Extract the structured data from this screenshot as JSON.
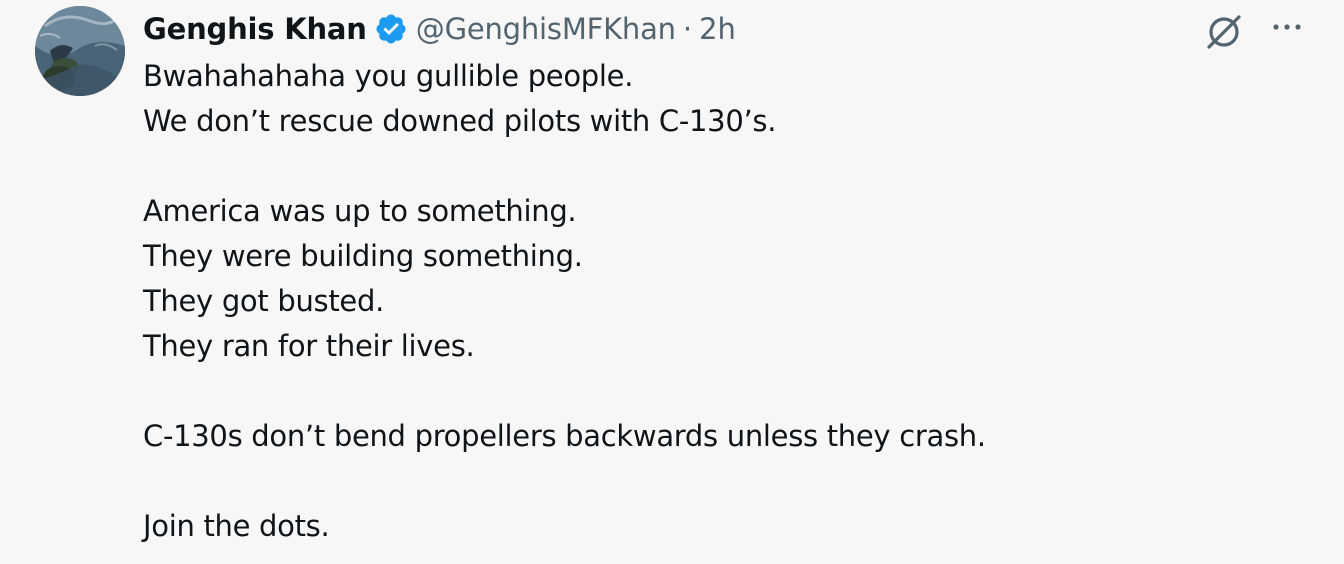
{
  "tweet": {
    "author_name": "Genghis Khan",
    "handle": "@GenghisMFKhan",
    "separator": "·",
    "time": "2h",
    "lines": [
      "Bwahahahaha you gullible people.",
      "We don’t rescue downed pilots with C-130’s.",
      "",
      "America was up to something.",
      "They were building something.",
      "They got busted.",
      "They ran for their lives.",
      "",
      "C-130s don’t bend propellers backwards unless they crash.",
      "",
      "Join the dots."
    ]
  },
  "icons": {
    "verified": "verified-badge-icon",
    "grok": "grok-icon",
    "more": "more-icon"
  },
  "colors": {
    "background": "#f7f7f7",
    "text": "#0f1419",
    "secondary": "#536471",
    "verified": "#1d9bf0"
  }
}
